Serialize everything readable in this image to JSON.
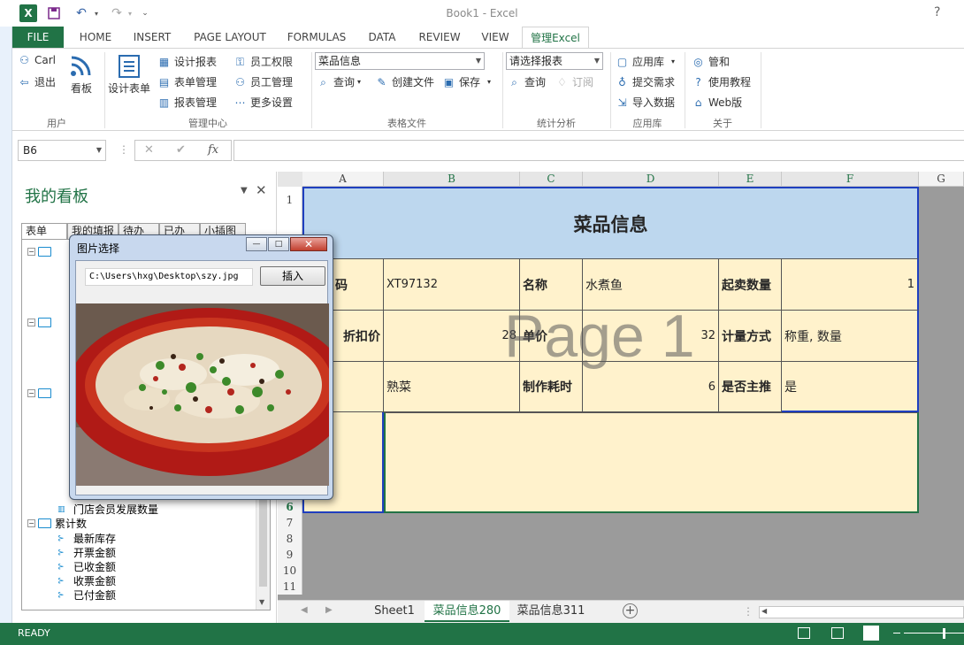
{
  "app": {
    "title": "Book1 - Excel",
    "help": "?",
    "qat": {
      "excel_icon": "excel-logo-icon",
      "save_icon": "save-icon",
      "undo_icon": "undo-icon",
      "redo_icon": "redo-icon",
      "customize_icon": "customize-qat-icon"
    }
  },
  "ribbon_tabs": [
    "FILE",
    "HOME",
    "INSERT",
    "PAGE LAYOUT",
    "FORMULAS",
    "DATA",
    "REVIEW",
    "VIEW",
    "管理Excel"
  ],
  "ribbon": {
    "user": {
      "name": "Carl",
      "logout": "退出",
      "group": "用户"
    },
    "board": {
      "label": "看板"
    },
    "design_form": {
      "label": "设计表单"
    },
    "manage": {
      "design_report": "设计报表",
      "form_manage": "表单管理",
      "report_manage": "报表管理",
      "emp_perm": "员工权限",
      "emp_manage": "员工管理",
      "more_settings": "更多设置",
      "group": "管理中心"
    },
    "table_file": {
      "combo": "菜品信息",
      "query": "查询",
      "create": "创建文件",
      "save": "保存",
      "group": "表格文件"
    },
    "stats": {
      "combo": "请选择报表",
      "query": "查询",
      "subscribe": "订阅",
      "group": "统计分析"
    },
    "applib": {
      "applib": "应用库",
      "submit": "提交需求",
      "import": "导入数据",
      "group": "应用库"
    },
    "about": {
      "guanhe": "管和",
      "tutorial": "使用教程",
      "web": "Web版",
      "group": "关于"
    }
  },
  "formula_bar": {
    "name_box": "B6",
    "cancel": "✕",
    "enter": "✔",
    "fx": "fx",
    "value": ""
  },
  "pane": {
    "title": "我的看板",
    "tabs": [
      "表单",
      "我的填报",
      "待办",
      "已办",
      "小插图"
    ],
    "tree": {
      "member_growth": "门店会员发展数量",
      "cumulative": "累计数",
      "items": [
        "最新库存",
        "开票金额",
        "已收金额",
        "收票金额",
        "已付金额"
      ]
    }
  },
  "grid": {
    "columns": [
      "A",
      "B",
      "C",
      "D",
      "E",
      "F",
      "G"
    ],
    "rows": [
      "1",
      "2",
      "3",
      "4",
      "5",
      "6",
      "7",
      "8",
      "9",
      "10",
      "11"
    ],
    "title": "菜品信息",
    "r2": {
      "a": "码",
      "b": "XT97132",
      "c": "名称",
      "d": "水煮鱼",
      "e": "起卖数量",
      "f": "1"
    },
    "r3": {
      "a": "折扣价",
      "b": "28",
      "c": "单价",
      "d": "32",
      "e": "计量方式",
      "f": "称重, 数量"
    },
    "r4": {
      "a": "",
      "b": "熟菜",
      "c": "制作耗时",
      "d": "6",
      "e": "是否主推",
      "f": "是"
    },
    "watermark": "Page 1"
  },
  "sheets": [
    "Sheet1",
    "菜品信息280",
    "菜品信息311"
  ],
  "status": {
    "text": "READY"
  },
  "dialog": {
    "title": "图片选择",
    "path": "C:\\Users\\hxg\\Desktop\\szy.jpg",
    "insert": "插入",
    "min": "—",
    "max": "□",
    "close": "✕"
  },
  "colors": {
    "excel_green": "#217346",
    "title_fill": "#bdd7ee",
    "cell_fill": "#fff2cc"
  }
}
